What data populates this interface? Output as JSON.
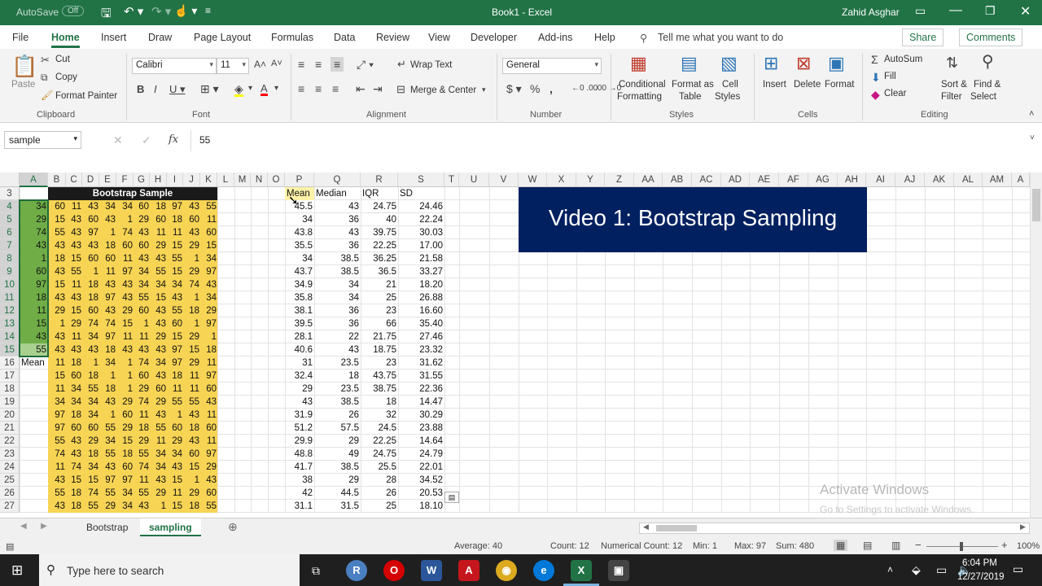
{
  "titlebar": {
    "autosave": "AutoSave",
    "autosave_state": "Off",
    "title": "Book1 - Excel",
    "user": "Zahid Asghar"
  },
  "tabs": [
    "File",
    "Home",
    "Insert",
    "Draw",
    "Page Layout",
    "Formulas",
    "Data",
    "Review",
    "View",
    "Developer",
    "Add-ins",
    "Help"
  ],
  "tell_me": "Tell me what you want to do",
  "share": "Share",
  "comments": "Comments",
  "ribbon": {
    "paste": "Paste",
    "cut": "Cut",
    "copy": "Copy",
    "format_painter": "Format Painter",
    "clipboard": "Clipboard",
    "font_name": "Calibri",
    "font_size": "11",
    "font": "Font",
    "wrap_text": "Wrap Text",
    "merge_center": "Merge & Center",
    "alignment": "Alignment",
    "number_format": "General",
    "number": "Number",
    "cond_format": "Conditional",
    "cond_format2": "Formatting",
    "format_table": "Format as",
    "format_table2": "Table",
    "cell_styles": "Cell",
    "cell_styles2": "Styles",
    "styles": "Styles",
    "insert": "Insert",
    "delete": "Delete",
    "format": "Format",
    "cells": "Cells",
    "autosum": "AutoSum",
    "fill": "Fill",
    "clear": "Clear",
    "sort": "Sort &",
    "sort2": "Filter",
    "find": "Find &",
    "find2": "Select",
    "editing": "Editing"
  },
  "formula": {
    "namebox": "sample",
    "value": "55"
  },
  "columns": [
    "A",
    "B",
    "C",
    "D",
    "E",
    "F",
    "G",
    "H",
    "I",
    "J",
    "K",
    "L",
    "M",
    "N",
    "O",
    "P",
    "Q",
    "R",
    "S",
    "T",
    "U",
    "V",
    "W",
    "X",
    "Y",
    "Z",
    "AA",
    "AB",
    "AC",
    "AD",
    "AE",
    "AF",
    "AG",
    "AH",
    "AI",
    "AJ",
    "AK",
    "AL",
    "AM",
    "A"
  ],
  "bootstrap_header": "Bootstrap Sample",
  "stat_headers": [
    "Mean",
    "Median",
    "IQR",
    "SD"
  ],
  "colA": [
    "34",
    "29",
    "74",
    "43",
    "1",
    "60",
    "97",
    "18",
    "11",
    "15",
    "43",
    "55"
  ],
  "mean_label": "Mean",
  "samples": [
    [
      "60",
      "11",
      "43",
      "34",
      "34",
      "60",
      "18",
      "97",
      "43",
      "55"
    ],
    [
      "15",
      "43",
      "60",
      "43",
      "1",
      "29",
      "60",
      "18",
      "60",
      "11"
    ],
    [
      "55",
      "43",
      "97",
      "1",
      "74",
      "43",
      "11",
      "11",
      "43",
      "60"
    ],
    [
      "43",
      "43",
      "43",
      "18",
      "60",
      "60",
      "29",
      "15",
      "29",
      "15"
    ],
    [
      "18",
      "15",
      "60",
      "60",
      "11",
      "43",
      "43",
      "55",
      "1",
      "34"
    ],
    [
      "43",
      "55",
      "1",
      "11",
      "97",
      "34",
      "55",
      "15",
      "29",
      "97"
    ],
    [
      "15",
      "11",
      "18",
      "43",
      "43",
      "34",
      "34",
      "34",
      "74",
      "43"
    ],
    [
      "43",
      "43",
      "18",
      "97",
      "43",
      "55",
      "15",
      "43",
      "1",
      "34"
    ],
    [
      "29",
      "15",
      "60",
      "43",
      "29",
      "60",
      "43",
      "55",
      "18",
      "29"
    ],
    [
      "1",
      "29",
      "74",
      "74",
      "15",
      "1",
      "43",
      "60",
      "1",
      "97"
    ],
    [
      "43",
      "11",
      "34",
      "97",
      "11",
      "11",
      "29",
      "15",
      "29",
      "1"
    ],
    [
      "43",
      "43",
      "43",
      "18",
      "43",
      "43",
      "43",
      "97",
      "15",
      "18"
    ],
    [
      "11",
      "18",
      "1",
      "34",
      "1",
      "74",
      "34",
      "97",
      "29",
      "11"
    ],
    [
      "15",
      "60",
      "18",
      "1",
      "1",
      "60",
      "43",
      "18",
      "11",
      "97"
    ],
    [
      "11",
      "34",
      "55",
      "18",
      "1",
      "29",
      "60",
      "11",
      "11",
      "60"
    ],
    [
      "34",
      "34",
      "34",
      "43",
      "29",
      "74",
      "29",
      "55",
      "55",
      "43"
    ],
    [
      "97",
      "18",
      "34",
      "1",
      "60",
      "11",
      "43",
      "1",
      "43",
      "11"
    ],
    [
      "97",
      "60",
      "60",
      "55",
      "29",
      "18",
      "55",
      "60",
      "18",
      "60"
    ],
    [
      "55",
      "43",
      "29",
      "34",
      "15",
      "29",
      "11",
      "29",
      "43",
      "11"
    ],
    [
      "74",
      "43",
      "18",
      "55",
      "18",
      "55",
      "34",
      "34",
      "60",
      "97"
    ],
    [
      "11",
      "74",
      "34",
      "43",
      "60",
      "74",
      "34",
      "43",
      "15",
      "29"
    ],
    [
      "43",
      "15",
      "15",
      "97",
      "97",
      "11",
      "43",
      "15",
      "1",
      "43"
    ],
    [
      "55",
      "18",
      "74",
      "55",
      "34",
      "55",
      "29",
      "11",
      "29",
      "60"
    ],
    [
      "43",
      "18",
      "55",
      "29",
      "34",
      "43",
      "1",
      "15",
      "18",
      "55"
    ]
  ],
  "stats": [
    [
      "45.5",
      "43",
      "24.75",
      "24.46"
    ],
    [
      "34",
      "36",
      "40",
      "22.24"
    ],
    [
      "43.8",
      "43",
      "39.75",
      "30.03"
    ],
    [
      "35.5",
      "36",
      "22.25",
      "17.00"
    ],
    [
      "34",
      "38.5",
      "36.25",
      "21.58"
    ],
    [
      "43.7",
      "38.5",
      "36.5",
      "33.27"
    ],
    [
      "34.9",
      "34",
      "21",
      "18.20"
    ],
    [
      "35.8",
      "34",
      "25",
      "26.88"
    ],
    [
      "38.1",
      "36",
      "23",
      "16.60"
    ],
    [
      "39.5",
      "36",
      "66",
      "35.40"
    ],
    [
      "28.1",
      "22",
      "21.75",
      "27.46"
    ],
    [
      "40.6",
      "43",
      "18.75",
      "23.32"
    ],
    [
      "31",
      "23.5",
      "23",
      "31.62"
    ],
    [
      "32.4",
      "18",
      "43.75",
      "31.55"
    ],
    [
      "29",
      "23.5",
      "38.75",
      "22.36"
    ],
    [
      "43",
      "38.5",
      "18",
      "14.47"
    ],
    [
      "31.9",
      "26",
      "32",
      "30.29"
    ],
    [
      "51.2",
      "57.5",
      "24.5",
      "23.88"
    ],
    [
      "29.9",
      "29",
      "22.25",
      "14.64"
    ],
    [
      "48.8",
      "49",
      "24.75",
      "24.79"
    ],
    [
      "41.7",
      "38.5",
      "25.5",
      "22.01"
    ],
    [
      "38",
      "29",
      "28",
      "34.52"
    ],
    [
      "42",
      "44.5",
      "26",
      "20.53"
    ],
    [
      "31.1",
      "31.5",
      "25",
      "18.10"
    ]
  ],
  "video_title": "Video 1: Bootstrap Sampling",
  "watermark1": "Activate Windows",
  "watermark2": "Go to Settings to activate Windows.",
  "sheets": [
    "Bootstrap",
    "sampling"
  ],
  "status": {
    "average": "Average: 40",
    "count": "Count: 12",
    "numcount": "Numerical Count: 12",
    "min": "Min: 1",
    "max": "Max: 97",
    "sum": "Sum: 480",
    "zoom": "100%"
  },
  "taskbar": {
    "search": "Type here to search",
    "time": "6:04 PM",
    "date": "12/27/2019"
  },
  "colors": {
    "excel_green": "#217346",
    "yellow": "#f7d454",
    "green_cell": "#70ad47",
    "navy": "#002060",
    "dark": "#1f1f1f"
  }
}
